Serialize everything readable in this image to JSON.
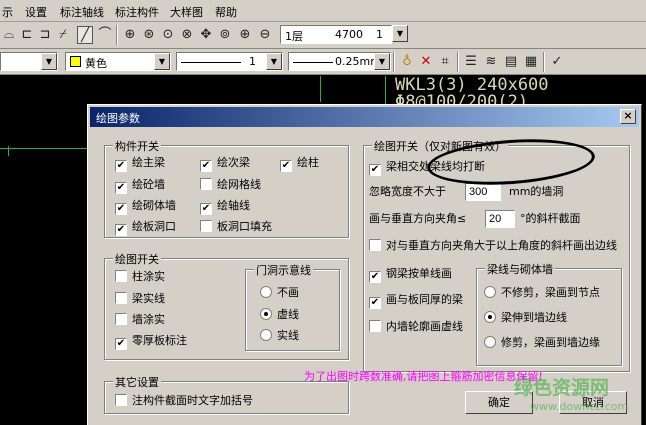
{
  "menu": [
    "示",
    "设置",
    "标注轴线",
    "标注构件",
    "大样图",
    "帮助"
  ],
  "toolbar1": {
    "icons": [
      "polygon-icon",
      "line-segment-icon",
      "angle-icon",
      "snap-tool-icon",
      "arc-tool-icon",
      "zoom-window-icon",
      "zoom-dynamic-icon",
      "zoom-previous-icon",
      "zoom-in-icon",
      "pan-icon",
      "zoom-extents-icon",
      "zoom-out-icon"
    ],
    "floor": "1层",
    "height": "4700",
    "count": "1"
  },
  "toolbar2": {
    "color": "黄色",
    "linetype_count": "1",
    "linewidth": "0.25mm",
    "icons": [
      "light-bulb-icon",
      "delete-cross-icon",
      "grid-snap-icon",
      "layer-list-icon",
      "layer-stack-icon",
      "layer-manager-icon",
      "layer-properties-icon"
    ]
  },
  "drawing": {
    "label1": "WKL3(3) 240x600",
    "label2": "Φ8@100/200(2)"
  },
  "dialog": {
    "title": "绘图参数",
    "close": "×",
    "component_switch": {
      "title": "构件开关",
      "items": [
        {
          "label": "绘主梁",
          "checked": true
        },
        {
          "label": "绘次梁",
          "checked": true
        },
        {
          "label": "绘柱",
          "checked": true
        },
        {
          "label": "绘砼墙",
          "checked": true
        },
        {
          "label": "绘网格线",
          "checked": false
        },
        {
          "label": "绘砌体墙",
          "checked": true
        },
        {
          "label": "绘轴线",
          "checked": true
        },
        {
          "label": "绘板洞口",
          "checked": true
        },
        {
          "label": "板洞口填充",
          "checked": false
        }
      ]
    },
    "draw_switch": {
      "title": "绘图开关",
      "items": [
        {
          "label": "柱涂实",
          "checked": false
        },
        {
          "label": "梁实线",
          "checked": false
        },
        {
          "label": "墙涂实",
          "checked": false
        },
        {
          "label": "零厚板标注",
          "checked": true
        }
      ],
      "door_hole": {
        "title": "门洞示意线",
        "options": [
          {
            "label": "不画",
            "selected": false
          },
          {
            "label": "虚线",
            "selected": true
          },
          {
            "label": "实线",
            "selected": false
          }
        ]
      }
    },
    "other": {
      "title": "其它设置",
      "item": {
        "label": "注构件截面时文字加括号",
        "checked": false
      }
    },
    "draw_switch_new": {
      "title": "绘图开关（仅对新图有效）",
      "beam_break": {
        "label": "梁相交处梁线均打断",
        "checked": true
      },
      "ignore_width_label": "忽略宽度不大于",
      "ignore_width_value": "300",
      "ignore_width_unit": "mm的墙洞",
      "angle_label": "画与垂直方向夹角≤",
      "angle_value": "20",
      "angle_unit": "°的斜杆截面",
      "outline": {
        "label": "对与垂直方向夹角大于以上角度的斜杆画出边线",
        "checked": false
      },
      "steel_beam": {
        "label": "钢梁按单线画",
        "checked": true
      },
      "same_thick": {
        "label": "画与板同厚的梁",
        "checked": true
      },
      "inner_wall": {
        "label": "内墙轮廓画虚线",
        "checked": false
      },
      "beam_wall": {
        "title": "梁线与砌体墙",
        "options": [
          {
            "label": "不修剪，梁画到节点",
            "selected": false
          },
          {
            "label": "梁伸到墙边线",
            "selected": true
          },
          {
            "label": "修剪，梁画到墙边缘",
            "selected": false
          }
        ]
      }
    },
    "ok": "确定",
    "cancel": "取消"
  },
  "notice": "为了出图时跨数准确,请把图上箍筋加密信息保留!",
  "watermark": "绿色资源网",
  "watermark_url": "www.downcc.com",
  "colors": {
    "accent": "#0a246a",
    "drawing_bg": "#000000",
    "notice": "#ff00ff"
  }
}
